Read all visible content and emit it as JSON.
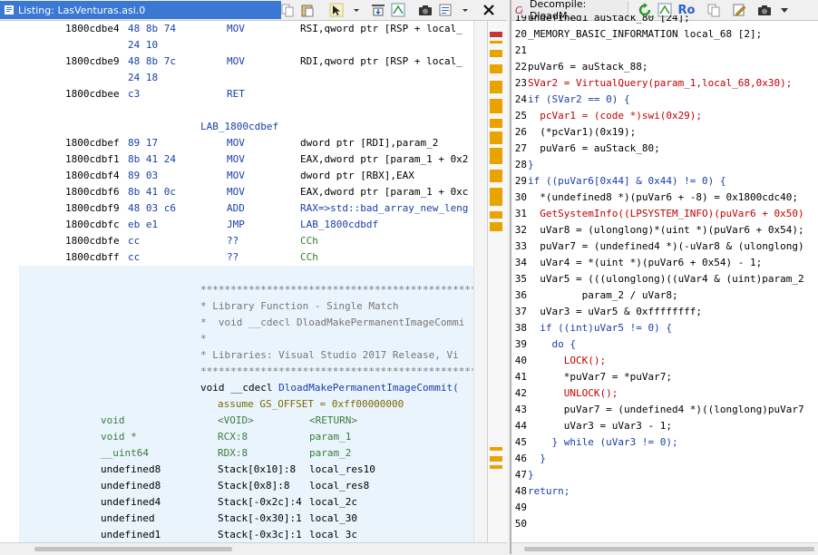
{
  "listing": {
    "tab_title": "Listing:  LasVenturas.asi.0",
    "lines": [
      {
        "addr": "1800cdbe4",
        "bytes": "48 8b 74",
        "mn": "MOV",
        "op": "RSI,qword ptr [RSP + local_"
      },
      {
        "addr": "",
        "bytes": "24 10",
        "mn": "",
        "op": ""
      },
      {
        "addr": "1800cdbe9",
        "bytes": "48 8b 7c",
        "mn": "MOV",
        "op": "RDI,qword ptr [RSP + local_"
      },
      {
        "addr": "",
        "bytes": "24 18",
        "mn": "",
        "op": ""
      },
      {
        "addr": "1800cdbee",
        "bytes": "c3",
        "mn": "RET",
        "op": ""
      },
      {
        "addr": "",
        "bytes": "",
        "mn": "",
        "op": ""
      },
      {
        "addr": "",
        "bytes": "",
        "mn": "",
        "op": ""
      },
      {
        "addr": "1800cdbef",
        "bytes": "89 17",
        "mn": "MOV",
        "op": "dword ptr [RDI],param_2"
      },
      {
        "addr": "1800cdbf1",
        "bytes": "8b 41 24",
        "mn": "MOV",
        "op": "EAX,dword ptr [param_1 + 0x2"
      },
      {
        "addr": "1800cdbf4",
        "bytes": "89 03",
        "mn": "MOV",
        "op": "dword ptr [RBX],EAX"
      },
      {
        "addr": "1800cdbf6",
        "bytes": "8b 41 0c",
        "mn": "MOV",
        "op": "EAX,dword ptr [param_1 + 0xc"
      },
      {
        "addr": "1800cdbf9",
        "bytes": "48 03 c6",
        "mn": "ADD",
        "op": "RAX=>std::bad_array_new_leng"
      },
      {
        "addr": "1800cdbfc",
        "bytes": "eb e1",
        "mn": "JMP",
        "op": "LAB_1800cdbdf"
      },
      {
        "addr": "1800cdbfe",
        "bytes": "cc",
        "mn": "??",
        "op": "CCh"
      },
      {
        "addr": "1800cdbff",
        "bytes": "cc",
        "mn": "??",
        "op": "CCh"
      }
    ],
    "label": "LAB_1800cdbef",
    "comment_stars": "**********************************************************",
    "comments": [
      "* Library Function - Single Match",
      "*  void __cdecl DloadMakePermanentImageCommi",
      "*",
      "* Libraries: Visual Studio 2017 Release, Vi"
    ],
    "signature_prefix": "void __cdecl ",
    "signature_func": "DloadMakePermanentImageCommit(",
    "assume": "assume GS_OFFSET = 0xff00000000",
    "vars": [
      {
        "type": "void",
        "loc": "<VOID>",
        "name": "<RETURN>"
      },
      {
        "type": "void *",
        "loc": "RCX:8",
        "name": "param_1"
      },
      {
        "type": "__uint64",
        "loc": "RDX:8",
        "name": "param_2"
      },
      {
        "type": "undefined8",
        "loc": "Stack[0x10]:8",
        "name": "local_res10"
      },
      {
        "type": "undefined8",
        "loc": "Stack[0x8]:8",
        "name": "local_res8"
      },
      {
        "type": "undefined4",
        "loc": "Stack[-0x2c]:4",
        "name": "local_2c"
      },
      {
        "type": "undefined",
        "loc": "Stack[-0x30]:1",
        "name": "local_30"
      },
      {
        "type": "undefined1",
        "loc": "Stack[-0x3c]:1",
        "name": "local 3c"
      }
    ]
  },
  "decompile": {
    "tab_title": "Decompile: DloadM...",
    "tab_extra": "Ro",
    "lines": [
      {
        "n": "19",
        "code": "undefined1 auStack_80 [24];"
      },
      {
        "n": "20",
        "code": "_MEMORY_BASIC_INFORMATION local_68 [2];"
      },
      {
        "n": "21",
        "code": ""
      },
      {
        "n": "22",
        "code": "puVar6 = auStack_88;"
      },
      {
        "n": "23",
        "code": "SVar2 = VirtualQuery(param_1,local_68,0x30);"
      },
      {
        "n": "24",
        "code": "if (SVar2 == 0) {"
      },
      {
        "n": "25",
        "code": "  pcVar1 = (code *)swi(0x29);"
      },
      {
        "n": "26",
        "code": "  (*pcVar1)(0x19);"
      },
      {
        "n": "27",
        "code": "  puVar6 = auStack_80;"
      },
      {
        "n": "28",
        "code": "}"
      },
      {
        "n": "29",
        "code": "if ((puVar6[0x44] & 0x44) != 0) {"
      },
      {
        "n": "30",
        "code": "  *(undefined8 *)(puVar6 + -8) = 0x1800cdc40;"
      },
      {
        "n": "31",
        "code": "  GetSystemInfo((LPSYSTEM_INFO)(puVar6 + 0x50)"
      },
      {
        "n": "32",
        "code": "  uVar8 = (ulonglong)*(uint *)(puVar6 + 0x54);"
      },
      {
        "n": "33",
        "code": "  puVar7 = (undefined4 *)(-uVar8 & (ulonglong)"
      },
      {
        "n": "34",
        "code": "  uVar4 = *(uint *)(puVar6 + 0x54) - 1;"
      },
      {
        "n": "35",
        "code": "  uVar5 = (((ulonglong)((uVar4 & (uint)param_2"
      },
      {
        "n": "36",
        "code": "         param_2 / uVar8;"
      },
      {
        "n": "37",
        "code": "  uVar3 = uVar5 & 0xffffffff;"
      },
      {
        "n": "38",
        "code": "  if ((int)uVar5 != 0) {"
      },
      {
        "n": "39",
        "code": "    do {"
      },
      {
        "n": "40",
        "code": "      LOCK();"
      },
      {
        "n": "41",
        "code": "      *puVar7 = *puVar7;"
      },
      {
        "n": "42",
        "code": "      UNLOCK();"
      },
      {
        "n": "43",
        "code": "      puVar7 = (undefined4 *)((longlong)puVar7"
      },
      {
        "n": "44",
        "code": "      uVar3 = uVar3 - 1;"
      },
      {
        "n": "45",
        "code": "    } while (uVar3 != 0);"
      },
      {
        "n": "46",
        "code": "  }"
      },
      {
        "n": "47",
        "code": "}"
      },
      {
        "n": "48",
        "code": "return;"
      },
      {
        "n": "49",
        "code": ""
      },
      {
        "n": "50",
        "code": ""
      }
    ]
  },
  "colors": {
    "accent": "#3b78d4",
    "code_blue": "#1a40a8",
    "code_green": "#2b7d2b",
    "code_red": "#c00000",
    "mark_orange": "#e8a300"
  }
}
